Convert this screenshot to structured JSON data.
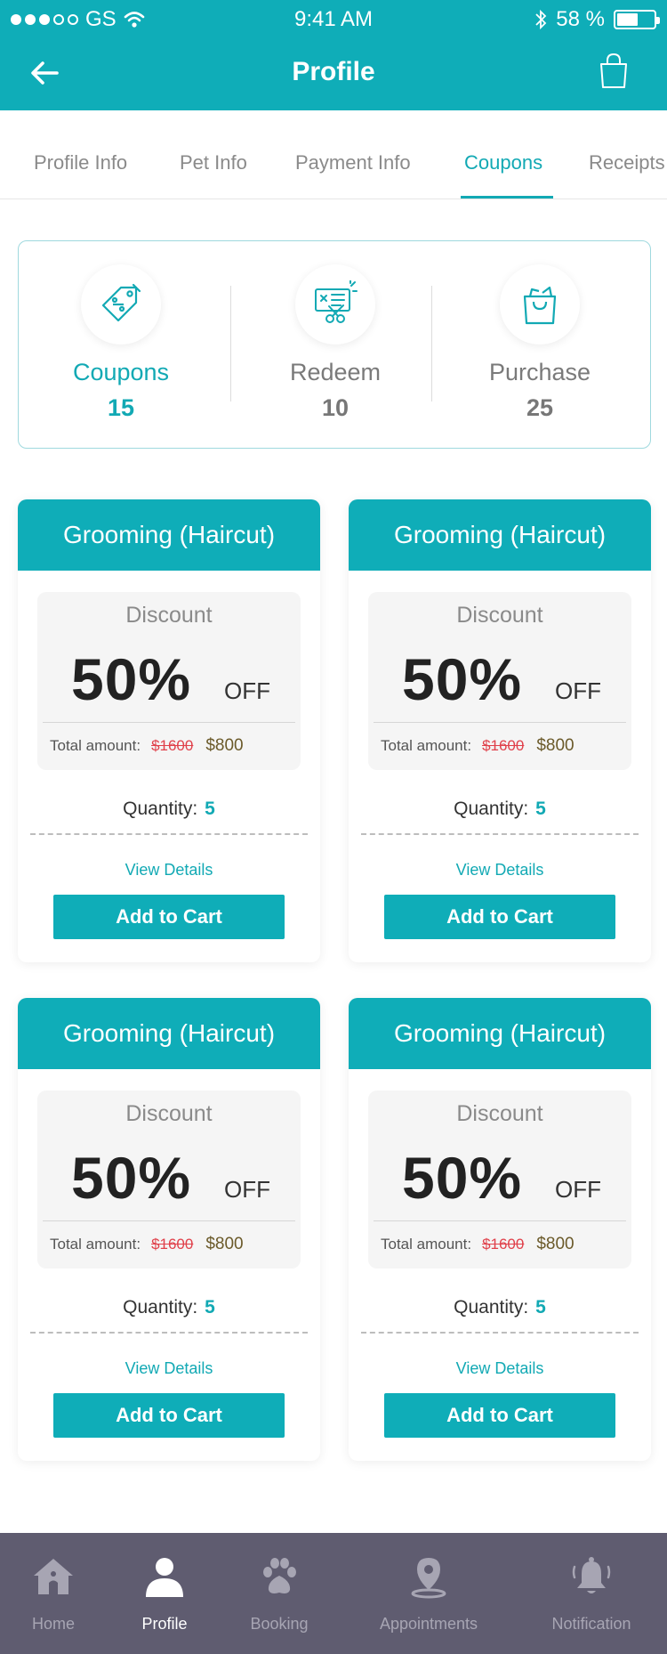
{
  "status_bar": {
    "carrier": "GS",
    "time": "9:41 AM",
    "battery": "58 %",
    "battery_level": 0.58
  },
  "header": {
    "title": "Profile",
    "back_icon": "arrow-left-icon",
    "cart_icon": "shopping-bag-icon"
  },
  "tabs": [
    {
      "label": "Profile Info",
      "active": false
    },
    {
      "label": "Pet Info",
      "active": false
    },
    {
      "label": "Payment Info",
      "active": false
    },
    {
      "label": "Coupons",
      "active": true
    },
    {
      "label": "Receipts",
      "active": false
    }
  ],
  "summary": [
    {
      "label": "Coupons",
      "count": "15",
      "icon": "coupon-tag-icon",
      "active": true
    },
    {
      "label": "Redeem",
      "count": "10",
      "icon": "redeem-ticket-icon",
      "active": false
    },
    {
      "label": "Purchase",
      "count": "25",
      "icon": "shopping-bag-icon",
      "active": false
    }
  ],
  "coupons": [
    {
      "title": "Grooming (Haircut)",
      "discount_label": "Discount",
      "discount_value": "50%",
      "discount_suffix": "OFF",
      "total_label": "Total amount:",
      "old_price": "$1600",
      "new_price": "$800",
      "quantity_label": "Quantity:",
      "quantity": "5",
      "view_details": "View Details",
      "add_to_cart": "Add to Cart"
    },
    {
      "title": "Grooming (Haircut)",
      "discount_label": "Discount",
      "discount_value": "50%",
      "discount_suffix": "OFF",
      "total_label": "Total amount:",
      "old_price": "$1600",
      "new_price": "$800",
      "quantity_label": "Quantity:",
      "quantity": "5",
      "view_details": "View Details",
      "add_to_cart": "Add to Cart"
    },
    {
      "title": "Grooming (Haircut)",
      "discount_label": "Discount",
      "discount_value": "50%",
      "discount_suffix": "OFF",
      "total_label": "Total amount:",
      "old_price": "$1600",
      "new_price": "$800",
      "quantity_label": "Quantity:",
      "quantity": "5",
      "view_details": "View Details",
      "add_to_cart": "Add to Cart"
    },
    {
      "title": "Grooming (Haircut)",
      "discount_label": "Discount",
      "discount_value": "50%",
      "discount_suffix": "OFF",
      "total_label": "Total amount:",
      "old_price": "$1600",
      "new_price": "$800",
      "quantity_label": "Quantity:",
      "quantity": "5",
      "view_details": "View Details",
      "add_to_cart": "Add to Cart"
    }
  ],
  "bottom_nav": [
    {
      "label": "Home",
      "icon": "home-icon",
      "active": false
    },
    {
      "label": "Profile",
      "icon": "user-icon",
      "active": true
    },
    {
      "label": "Booking",
      "icon": "paw-icon",
      "active": false
    },
    {
      "label": "Appointments",
      "icon": "map-pin-icon",
      "active": false
    },
    {
      "label": "Notification",
      "icon": "bell-icon",
      "active": false
    }
  ],
  "colors": {
    "primary": "#0fadb8",
    "accent_text": "#12a9b4",
    "price_old": "#e0414b",
    "bottom_bar": "#5f5c70"
  }
}
